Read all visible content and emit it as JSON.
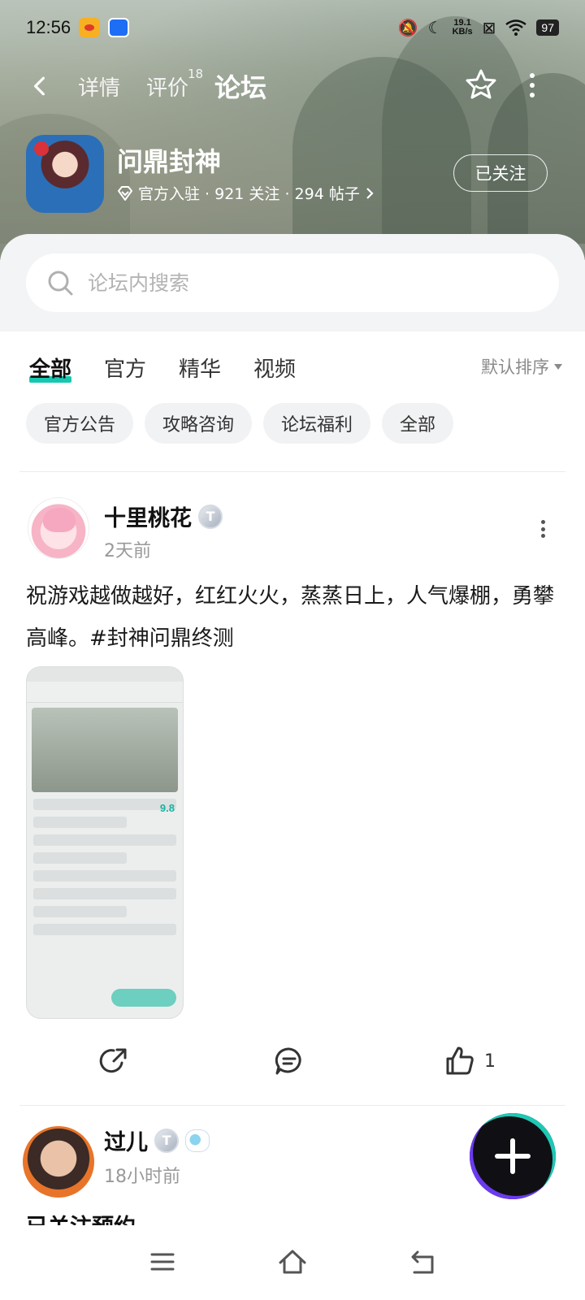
{
  "status_bar": {
    "time": "12:56",
    "net_speed_value": "19.1",
    "net_speed_unit": "KB/s",
    "battery": "97"
  },
  "nav": {
    "tabs": [
      {
        "label": "详情"
      },
      {
        "label": "评价",
        "badge": "18"
      },
      {
        "label": "论坛"
      }
    ],
    "active_tab": "论坛"
  },
  "game": {
    "name": "问鼎封神",
    "meta": "官方入驻 · 921 关注 · 294 帖子",
    "follow_label": "已关注"
  },
  "search": {
    "placeholder": "论坛内搜索"
  },
  "forum_tabs": [
    "全部",
    "官方",
    "精华",
    "视频"
  ],
  "sort_label": "默认排序",
  "chips": [
    "官方公告",
    "攻略咨询",
    "论坛福利",
    "全部"
  ],
  "posts": [
    {
      "author": "十里桃花",
      "level": "T",
      "time": "2天前",
      "text": "祝游戏越做越好，红红火火，蒸蒸日上，人气爆棚，勇攀高峰。#封神问鼎终测",
      "screenshot_score": "9.8",
      "likes": "1"
    },
    {
      "author": "过儿",
      "level": "T",
      "time": "18小时前",
      "title": "已关注预约"
    }
  ],
  "colors": {
    "accent": "#16c8b0",
    "text_primary": "#1a1a1a",
    "text_secondary": "#999999",
    "chip_bg": "#f1f2f4"
  },
  "icons": {
    "back": "chevron-left-icon",
    "favorite": "star-icon",
    "more": "more-vertical-icon",
    "search": "search-icon",
    "share": "share-icon",
    "comment": "comment-icon",
    "like": "thumbs-up-icon",
    "fab": "plus-icon"
  }
}
